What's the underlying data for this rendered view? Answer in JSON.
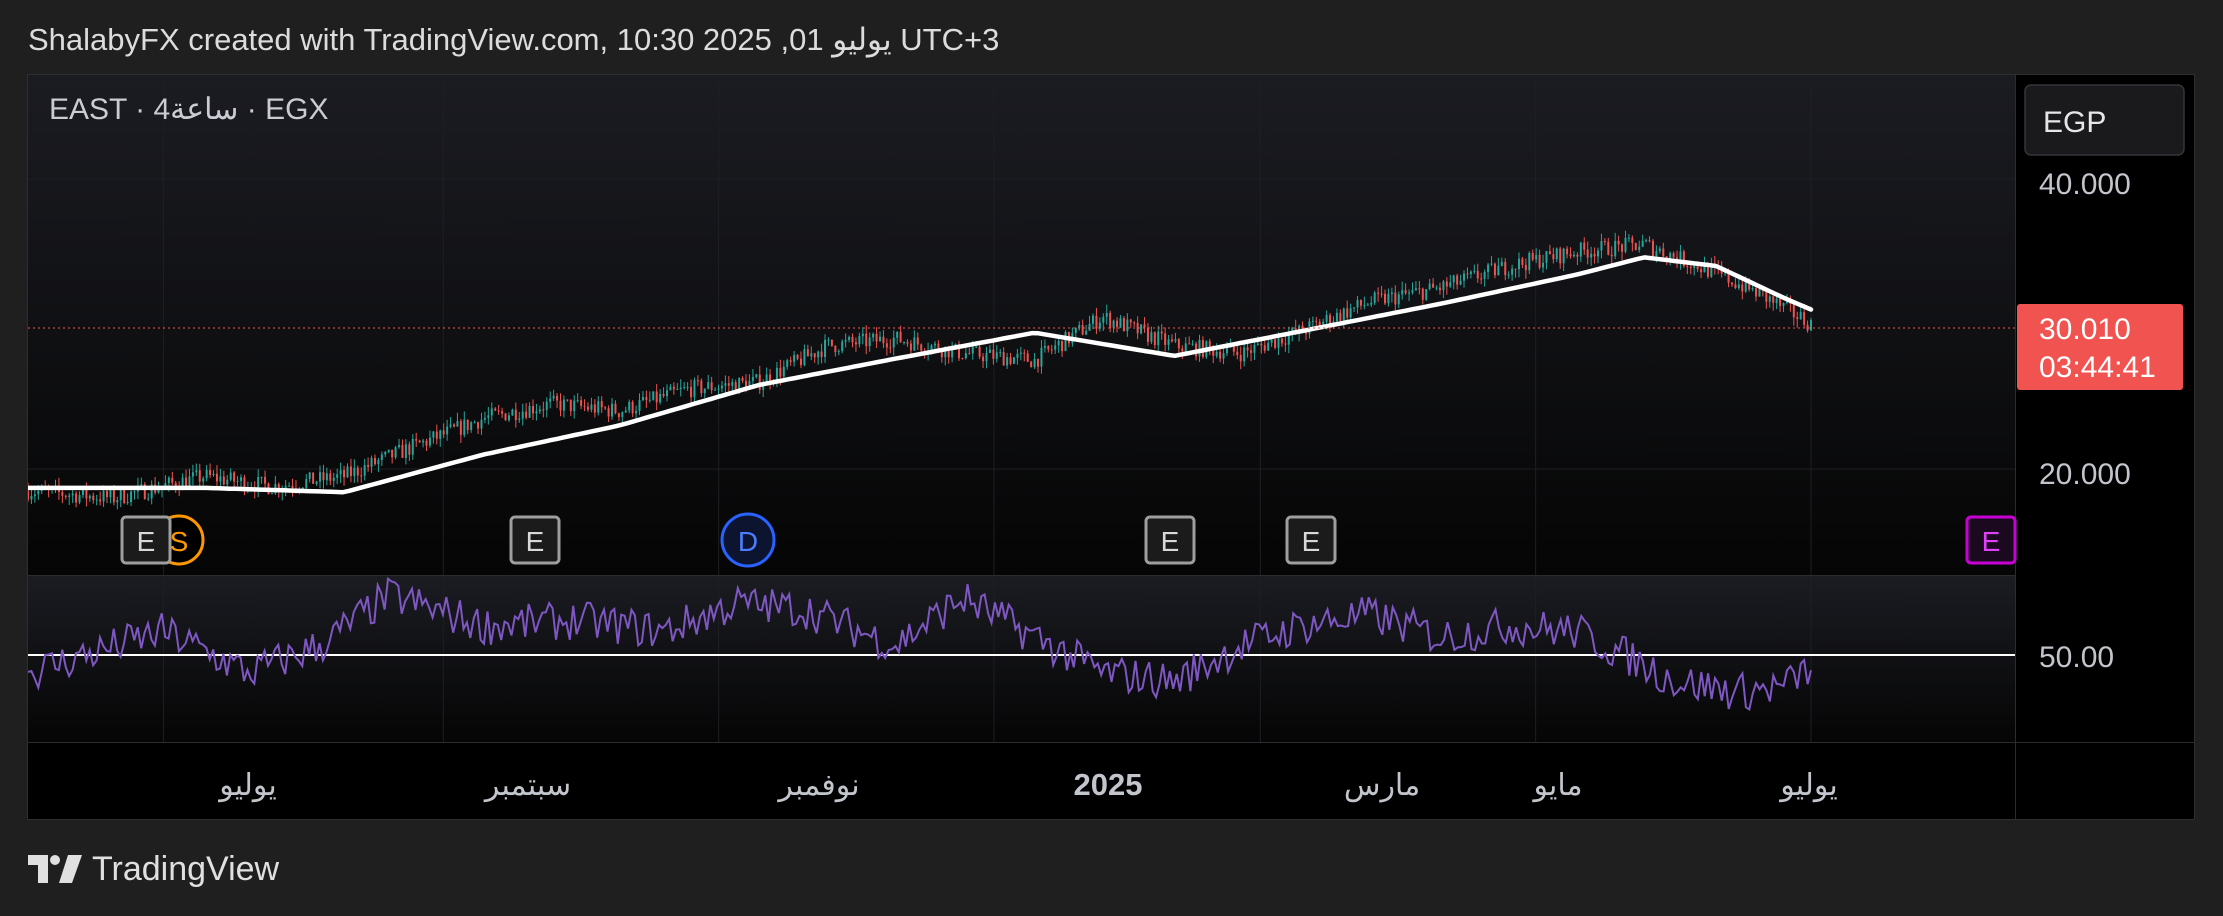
{
  "header": {
    "caption": "ShalabyFX created with TradingView.com, 10:30 2025 ,01 يوليو UTC+3"
  },
  "legend": {
    "symbol_line": "EAST · 4ساعة · EGX"
  },
  "currency_button": {
    "label": "EGP"
  },
  "price_axis": {
    "ticks": [
      "40.000",
      "20.000"
    ]
  },
  "rsi_axis": {
    "ticks": [
      "50.00"
    ]
  },
  "last_price": {
    "price": "30.010",
    "countdown": "03:44:41"
  },
  "time_axis": {
    "labels": [
      "يوليو",
      "سبتمبر",
      "نوفمبر",
      "2025",
      "مارس",
      "مايو",
      "يوليو"
    ]
  },
  "event_markers": [
    {
      "letter": "E",
      "kind": "earnings"
    },
    {
      "letter": "S",
      "kind": "split"
    },
    {
      "letter": "E",
      "kind": "earnings"
    },
    {
      "letter": "D",
      "kind": "dividend"
    },
    {
      "letter": "E",
      "kind": "earnings"
    },
    {
      "letter": "E",
      "kind": "earnings"
    },
    {
      "letter": "E",
      "kind": "earnings-upcoming"
    }
  ],
  "footer": {
    "brand": "TradingView"
  },
  "colors": {
    "up": "#26a69a",
    "down": "#ef5350",
    "ma_line": "#ffffff",
    "rsi_line": "#7e57c2",
    "last_price_bg": "#f05350",
    "earnings_marker": "#9e9e9e",
    "split_marker": "#ff9800",
    "dividend_marker": "#2962ff",
    "upcoming_marker": "#c800d6"
  },
  "chart_data": [
    {
      "type": "candlestick",
      "title": "EAST · 4ساعة · EGX",
      "x_range": [
        "2024-06",
        "2025-07-01"
      ],
      "ylim": [
        16,
        44
      ],
      "x_tick_labels": [
        "يوليو",
        "سبتمبر",
        "نوفمبر",
        "2025",
        "مارس",
        "مايو",
        "يوليو"
      ],
      "y_tick_labels": [
        "40.000",
        "20.000"
      ],
      "last_price": 30.01,
      "series": [
        {
          "kind": "price-approx",
          "x": [
            "2024-06-01",
            "2024-06-20",
            "2024-07-10",
            "2024-07-25",
            "2024-08-10",
            "2024-08-25",
            "2024-09-10",
            "2024-09-25",
            "2024-10-10",
            "2024-10-25",
            "2024-11-10",
            "2024-11-25",
            "2024-12-10",
            "2024-12-25",
            "2025-01-10",
            "2025-01-25",
            "2025-02-10",
            "2025-02-25",
            "2025-03-10",
            "2025-03-25",
            "2025-04-10",
            "2025-04-25",
            "2025-05-10",
            "2025-05-25",
            "2025-06-10",
            "2025-06-20",
            "2025-07-01"
          ],
          "values": [
            18.5,
            18.0,
            19.5,
            18.8,
            19.5,
            21.5,
            23.5,
            24.5,
            24.0,
            25.5,
            26.0,
            28.5,
            29.0,
            28.0,
            27.5,
            30.5,
            28.5,
            28.0,
            29.5,
            31.5,
            32.5,
            34.0,
            35.0,
            35.5,
            33.5,
            32.0,
            30.01
          ]
        },
        {
          "kind": "moving-average",
          "x": [
            "2024-06-01",
            "2024-07-10",
            "2024-08-10",
            "2024-09-10",
            "2024-10-10",
            "2024-11-10",
            "2024-12-10",
            "2025-01-10",
            "2025-02-10",
            "2025-03-10",
            "2025-04-10",
            "2025-05-10",
            "2025-05-25",
            "2025-06-10",
            "2025-06-25",
            "2025-07-01"
          ],
          "values": [
            18.7,
            18.7,
            18.4,
            21.0,
            23.0,
            25.8,
            27.6,
            29.4,
            27.8,
            29.5,
            31.4,
            33.4,
            34.6,
            34.0,
            31.8,
            31.0
          ]
        }
      ]
    },
    {
      "type": "line",
      "title": "RSI",
      "ylim": [
        20,
        80
      ],
      "y_tick_labels": [
        "50.00"
      ],
      "reference_line": 50,
      "series": [
        {
          "name": "",
          "x": [
            "2024-06-01",
            "2024-07-01",
            "2024-07-20",
            "2024-08-05",
            "2024-08-20",
            "2024-09-10",
            "2024-10-01",
            "2024-10-20",
            "2024-11-05",
            "2024-11-20",
            "2024-12-10",
            "2024-12-25",
            "2025-01-10",
            "2025-01-25",
            "2025-02-10",
            "2025-02-25",
            "2025-03-10",
            "2025-03-25",
            "2025-04-10",
            "2025-04-25",
            "2025-05-10",
            "2025-05-20",
            "2025-06-01",
            "2025-06-15",
            "2025-06-25",
            "2025-07-01"
          ],
          "values": [
            45,
            60,
            45,
            55,
            73,
            62,
            64,
            60,
            70,
            68,
            55,
            72,
            58,
            45,
            42,
            55,
            62,
            66,
            58,
            62,
            60,
            52,
            42,
            38,
            40,
            47
          ]
        }
      ]
    }
  ]
}
